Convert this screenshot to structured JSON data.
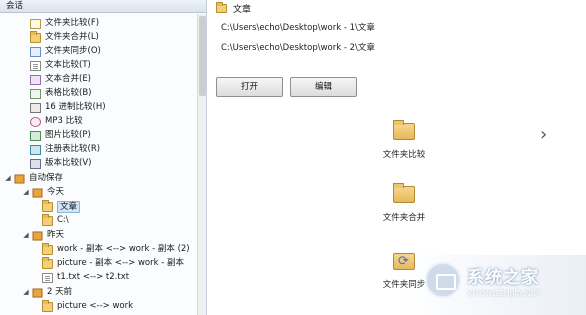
{
  "left_panel": {
    "header": "会话",
    "tools": [
      {
        "label": "文件夹比较(F)",
        "icon": "folder-compare-icon"
      },
      {
        "label": "文件夹合并(L)",
        "icon": "folder-merge-icon"
      },
      {
        "label": "文件夹同步(O)",
        "icon": "folder-sync-icon"
      },
      {
        "label": "文本比较(T)",
        "icon": "text-compare-icon"
      },
      {
        "label": "文本合并(E)",
        "icon": "text-merge-icon"
      },
      {
        "label": "表格比较(B)",
        "icon": "table-compare-icon"
      },
      {
        "label": "16 进制比较(H)",
        "icon": "hex-compare-icon"
      },
      {
        "label": "MP3 比较",
        "icon": "mp3-compare-icon"
      },
      {
        "label": "图片比较(P)",
        "icon": "picture-compare-icon"
      },
      {
        "label": "注册表比较(R)",
        "icon": "registry-compare-icon"
      },
      {
        "label": "版本比较(V)",
        "icon": "version-compare-icon"
      }
    ],
    "auto_save": {
      "label": "自动保存",
      "groups": [
        {
          "label": "今天",
          "items": [
            "文章",
            "C:\\"
          ]
        },
        {
          "label": "昨天",
          "items": [
            "work - 副本 <--> work - 副本 (2)",
            "picture - 副本 <--> work - 副本",
            "t1.txt <--> t2.txt"
          ]
        },
        {
          "label": "2 天前",
          "items": [
            "picture <--> work"
          ]
        }
      ]
    },
    "selected_item": "文章"
  },
  "right_panel": {
    "title": "文章",
    "path_1": "C:\\Users\\echo\\Desktop\\work - 1\\文章",
    "path_2": "C:\\Users\\echo\\Desktop\\work - 2\\文章",
    "open_button": "打开",
    "edit_button": "编辑",
    "actions": [
      {
        "label": "文件夹比较",
        "icon": "folder-icon"
      },
      {
        "label": "文件夹合并",
        "icon": "folder-merge-icon"
      },
      {
        "label": "文件夹同步",
        "icon": "folder-sync-icon"
      }
    ],
    "next_icon": "chevron-right-icon"
  },
  "watermark": {
    "name": "系统之家",
    "url": "XITONGZHIJIA.NET"
  }
}
